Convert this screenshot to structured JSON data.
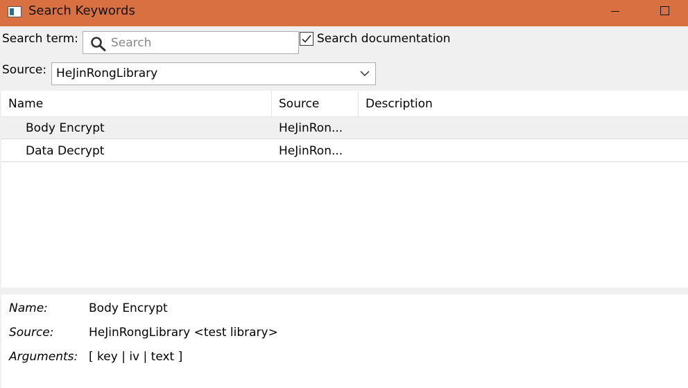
{
  "window": {
    "title": "Search Keywords",
    "accent_color": "#d97041",
    "icons": [
      "app-icon",
      "minimize-icon",
      "maximize-icon"
    ]
  },
  "search": {
    "term_label": "Search term:",
    "placeholder": "Search",
    "value": "",
    "doc_checkbox_label": "Search documentation",
    "doc_checked": true
  },
  "source": {
    "label": "Source:",
    "selected": "HeJinRongLibrary"
  },
  "table": {
    "columns": [
      "Name",
      "Source",
      "Description"
    ],
    "rows": [
      {
        "name": "Body Encrypt",
        "source": "HeJinRon...",
        "description": ""
      },
      {
        "name": "Data Decrypt",
        "source": "HeJinRon...",
        "description": ""
      }
    ],
    "selected_index": 0
  },
  "details": {
    "name_label": "Name:",
    "name_value": "Body Encrypt",
    "source_label": "Source:",
    "source_value": "HeJinRongLibrary <test library>",
    "args_label": "Arguments:",
    "args_value": "[ key | iv | text ]"
  }
}
